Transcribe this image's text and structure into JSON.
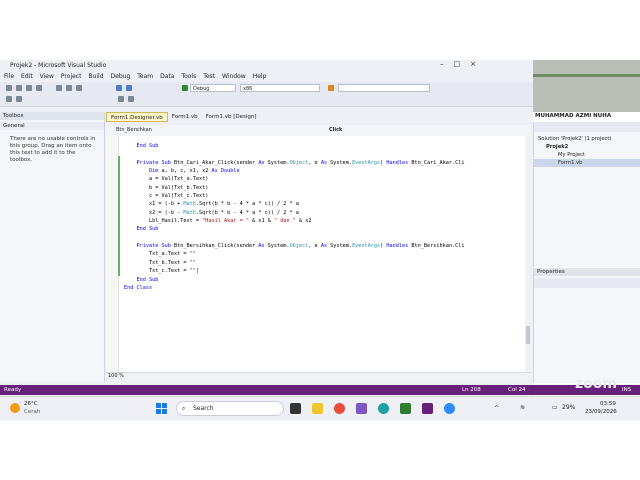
{
  "app": {
    "title": "Projek2 - Microsoft Visual Studio",
    "menu": [
      "File",
      "Edit",
      "View",
      "Project",
      "Build",
      "Debug",
      "Team",
      "Data",
      "Tools",
      "Test",
      "Window",
      "Help"
    ],
    "toolbar": {
      "config": "Debug",
      "platform": "x86"
    }
  },
  "toolbox": {
    "title": "Toolbox",
    "group": "General",
    "message": "There are no usable controls in this group. Drag an item onto this text to add it to the toolbox."
  },
  "editor": {
    "tabs": [
      "Form1.Designer.vb",
      "Form1.vb",
      "Form1.vb [Design]"
    ],
    "nav_left": "Btn_Bersihkan",
    "nav_right": "Click",
    "zoom": "100 %",
    "lines": [
      {
        "indent": "    ",
        "parts": [
          {
            "t": "End Sub",
            "c": "kw"
          }
        ]
      },
      {
        "indent": "",
        "parts": []
      },
      {
        "indent": "    ",
        "parts": [
          {
            "t": "Private Sub",
            "c": "kw"
          },
          {
            "t": " Btn_Cari_Akar_Click(sender ",
            "c": ""
          },
          {
            "t": "As",
            "c": "kw"
          },
          {
            "t": " System.",
            "c": ""
          },
          {
            "t": "Object",
            "c": "ty"
          },
          {
            "t": ", e ",
            "c": ""
          },
          {
            "t": "As",
            "c": "kw"
          },
          {
            "t": " System.",
            "c": ""
          },
          {
            "t": "EventArgs",
            "c": "ty"
          },
          {
            "t": ") ",
            "c": ""
          },
          {
            "t": "Handles",
            "c": "kw"
          },
          {
            "t": " Btn_Cari_Akar.Cli",
            "c": ""
          }
        ]
      },
      {
        "indent": "        ",
        "parts": [
          {
            "t": "Dim",
            "c": "kw"
          },
          {
            "t": " a, b, c, x1, x2 ",
            "c": ""
          },
          {
            "t": "As Double",
            "c": "kw"
          }
        ]
      },
      {
        "indent": "        ",
        "parts": [
          {
            "t": "a = Val(Txt_a.Text)",
            "c": ""
          }
        ]
      },
      {
        "indent": "        ",
        "parts": [
          {
            "t": "b = Val(Txt_b.Text)",
            "c": ""
          }
        ]
      },
      {
        "indent": "        ",
        "parts": [
          {
            "t": "c = Val(Txt_c.Text)",
            "c": ""
          }
        ]
      },
      {
        "indent": "        ",
        "parts": [
          {
            "t": "x1 = (-b + ",
            "c": ""
          },
          {
            "t": "Math",
            "c": "ty"
          },
          {
            "t": ".Sqrt(b * b - 4 * a * c)) / 2 * a",
            "c": ""
          }
        ]
      },
      {
        "indent": "        ",
        "parts": [
          {
            "t": "x2 = (-b - ",
            "c": ""
          },
          {
            "t": "Math",
            "c": "ty"
          },
          {
            "t": ".Sqrt(b * b - 4 * a * c)) / 2 * a",
            "c": ""
          }
        ]
      },
      {
        "indent": "        ",
        "parts": [
          {
            "t": "Lbl_Hasil.Text = ",
            "c": ""
          },
          {
            "t": "\"Hasil Akar = \"",
            "c": "str"
          },
          {
            "t": " & x1 & ",
            "c": ""
          },
          {
            "t": "\" dan \"",
            "c": "str"
          },
          {
            "t": " & x2",
            "c": ""
          }
        ]
      },
      {
        "indent": "    ",
        "parts": [
          {
            "t": "End Sub",
            "c": "kw"
          }
        ]
      },
      {
        "indent": "",
        "parts": []
      },
      {
        "indent": "    ",
        "parts": [
          {
            "t": "Private Sub",
            "c": "kw"
          },
          {
            "t": " Btn_Bersihkan_Click(sender ",
            "c": ""
          },
          {
            "t": "As",
            "c": "kw"
          },
          {
            "t": " System.",
            "c": ""
          },
          {
            "t": "Object",
            "c": "ty"
          },
          {
            "t": ", e ",
            "c": ""
          },
          {
            "t": "As",
            "c": "kw"
          },
          {
            "t": " System.",
            "c": ""
          },
          {
            "t": "EventArgs",
            "c": "ty"
          },
          {
            "t": ") ",
            "c": ""
          },
          {
            "t": "Handles",
            "c": "kw"
          },
          {
            "t": " Btn_Bersihkan.Cli",
            "c": ""
          }
        ]
      },
      {
        "indent": "        ",
        "parts": [
          {
            "t": "Txt_a.Text = ",
            "c": ""
          },
          {
            "t": "\"\"",
            "c": "str"
          }
        ]
      },
      {
        "indent": "        ",
        "parts": [
          {
            "t": "Txt_b.Text = ",
            "c": ""
          },
          {
            "t": "\"\"",
            "c": "str"
          }
        ]
      },
      {
        "indent": "        ",
        "parts": [
          {
            "t": "Txt_c.Text = ",
            "c": ""
          },
          {
            "t": "\"\"",
            "c": "str"
          },
          {
            "t": "|",
            "c": ""
          }
        ]
      },
      {
        "indent": "    ",
        "parts": [
          {
            "t": "End Sub",
            "c": "kw"
          }
        ]
      },
      {
        "indent": "",
        "parts": [
          {
            "t": "End Class",
            "c": "kw"
          }
        ]
      }
    ]
  },
  "solution": {
    "label": "MUHAMMAD AZMI NUHA",
    "tree": [
      "Solution 'Projek2' (1 project)",
      "Projek2",
      "My Project",
      "Form1.vb"
    ]
  },
  "properties": {
    "title": "Properties"
  },
  "status": {
    "ready": "Ready",
    "line": "Ln 208",
    "col": "Col 24",
    "ins": "INS",
    "brand": "zoom"
  },
  "taskbar": {
    "weather_temp": "26°C",
    "weather_desc": "Cerah",
    "search": "Search",
    "battery": "29%",
    "time": "03:59",
    "date": "23/09/2026"
  }
}
